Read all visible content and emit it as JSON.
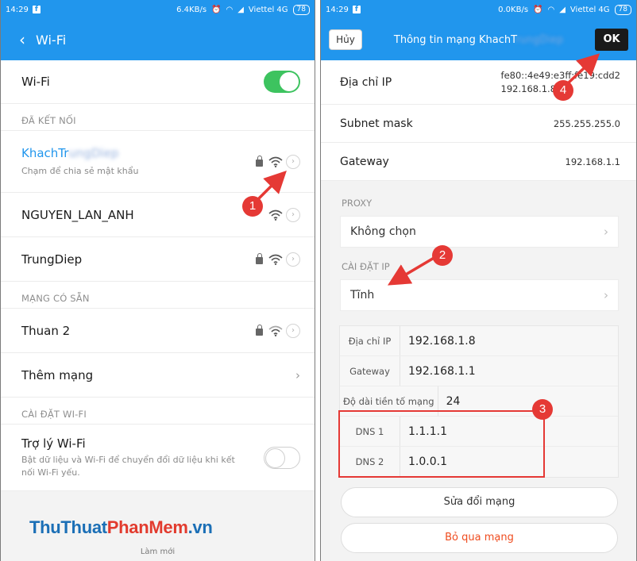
{
  "left": {
    "status": {
      "time": "14:29",
      "speed": "6.4KB/s",
      "carrier": "Viettel 4G",
      "battery": "78"
    },
    "appbar": {
      "title": "Wi-Fi"
    },
    "wifi_toggle_label": "Wi-Fi",
    "connected_header": "ĐÃ KẾT NỐI",
    "connected": {
      "name": "KhachTr",
      "name_hidden": "ungDiep",
      "sub": "Chạm để chia sẻ mật khẩu"
    },
    "networks": [
      {
        "name": "NGUYEN_LAN_ANH"
      },
      {
        "name": "TrungDiep"
      }
    ],
    "available_header": "MẠNG CÓ SẴN",
    "available": [
      {
        "name": "Thuan 2"
      }
    ],
    "add_network": "Thêm mạng",
    "settings_header": "CÀI ĐẶT WI-FI",
    "assistant": {
      "title": "Trợ lý Wi-Fi",
      "desc": "Bật dữ liệu và Wi-Fi để chuyển đổi dữ liệu khi kết nối Wi-Fi yếu."
    },
    "refresh_label": "Làm mới",
    "watermark_a": "ThuThuat",
    "watermark_b": "PhanMem",
    "watermark_c": ".vn"
  },
  "right": {
    "status": {
      "time": "14:29",
      "speed": "0.0KB/s",
      "carrier": "Viettel 4G",
      "battery": "78"
    },
    "cancel_label": "Hủy",
    "title": "Thông tin mạng KhachT",
    "title_hidden": "rungDiep",
    "ok_label": "OK",
    "ip_label": "Địa chỉ IP",
    "ip_value_1": "fe80::4e49:e3ff:fe19:cdd2",
    "ip_value_2": "192.168.1.8",
    "subnet_label": "Subnet mask",
    "subnet_value": "255.255.255.0",
    "gateway_label": "Gateway",
    "gateway_value": "192.168.1.1",
    "proxy_header": "PROXY",
    "proxy_value": "Không chọn",
    "ip_settings_header": "CÀI ĐẶT IP",
    "ip_settings_value": "Tĩnh",
    "static": {
      "ip_label": "Địa chỉ IP",
      "ip_value": "192.168.1.8",
      "gw_label": "Gateway",
      "gw_value": "192.168.1.1",
      "prefix_label": "Độ dài tiền tố mạng",
      "prefix_value": "24",
      "dns1_label": "DNS 1",
      "dns1_value": "1.1.1.1",
      "dns2_label": "DNS 2",
      "dns2_value": "1.0.0.1"
    },
    "modify_label": "Sửa đổi mạng",
    "forget_label": "Bỏ qua mạng"
  },
  "callouts": [
    "1",
    "2",
    "3",
    "4"
  ],
  "colors": {
    "accent": "#2196ed",
    "annotation": "#e53935",
    "toggle_on": "#3dc35f"
  }
}
